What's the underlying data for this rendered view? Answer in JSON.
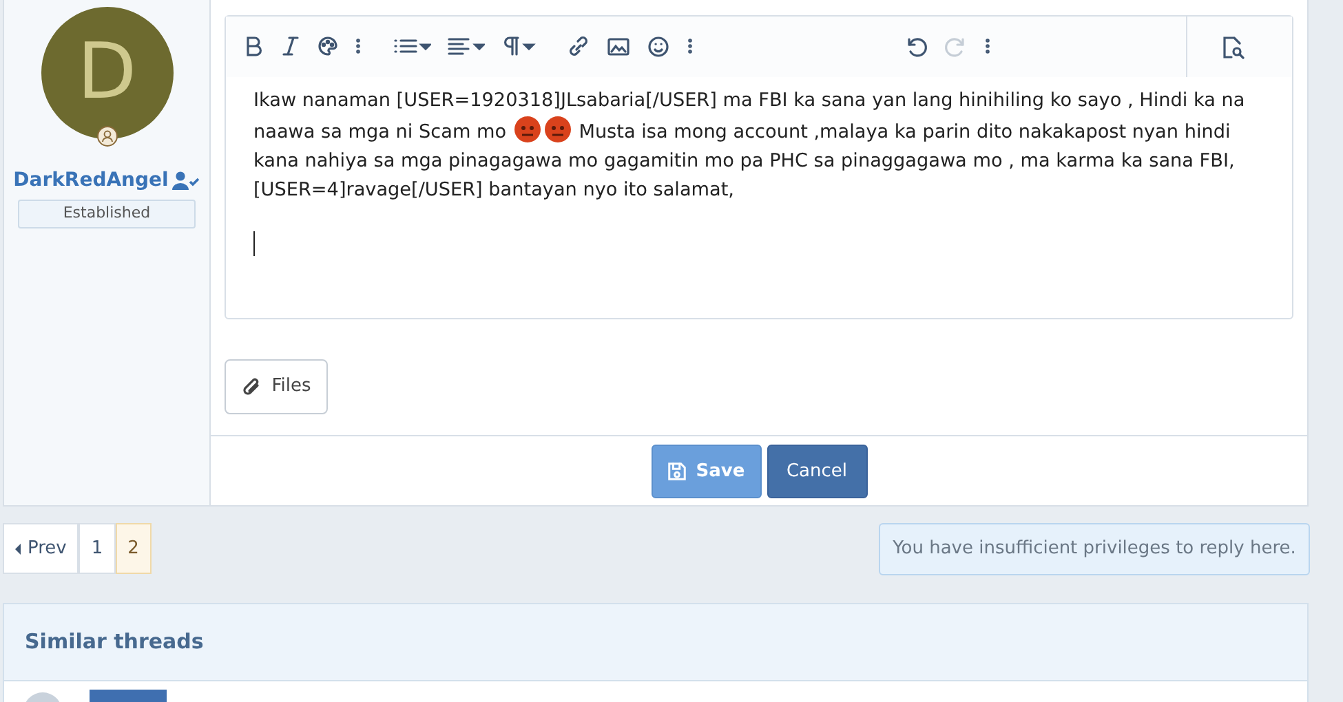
{
  "user": {
    "avatar_letter": "D",
    "name": "DarkRedAngel",
    "title": "Established"
  },
  "toolbar": [
    {
      "kind": "bold",
      "disabled": false
    },
    {
      "kind": "italic",
      "disabled": false
    },
    {
      "kind": "palette",
      "disabled": false
    },
    {
      "kind": "more",
      "disabled": false
    },
    {
      "kind": "list",
      "disabled": false
    },
    {
      "kind": "align",
      "disabled": false
    },
    {
      "kind": "paragraph",
      "disabled": false
    },
    {
      "kind": "link",
      "disabled": false
    },
    {
      "kind": "image",
      "disabled": false
    },
    {
      "kind": "smiley",
      "disabled": false
    },
    {
      "kind": "more",
      "disabled": false
    },
    {
      "kind": "undo",
      "disabled": false
    },
    {
      "kind": "redo",
      "disabled": true
    },
    {
      "kind": "more",
      "disabled": false
    },
    {
      "kind": "preview",
      "disabled": false
    }
  ],
  "editor": {
    "paragraphs": [
      [
        {
          "kind": "text",
          "text": "Ikaw nanaman [USER=1920318]JLsabaria[/USER] ma FBI ka sana yan lang hinihiling ko sayo , Hindi ka na naawa sa mga ni Scam mo "
        },
        {
          "kind": "emoji"
        },
        {
          "kind": "emoji"
        },
        {
          "kind": "text",
          "text": " Musta isa mong account ,malaya ka parin dito nakakapost nyan hindi kana nahiya sa mga pinagagawa mo gagamitin mo pa PHC sa pinaggagawa mo , ma karma ka sana FBI,"
        }
      ],
      [
        {
          "kind": "text",
          "text": "[USER=4]ravage[/USER] bantayan nyo ito salamat,"
        }
      ]
    ]
  },
  "files_button": "Files",
  "buttons": [
    {
      "kind": "save",
      "label": "Save"
    },
    {
      "kind": "cancel",
      "label": "Cancel"
    }
  ],
  "pagination": [
    {
      "kind": "prev",
      "label": "Prev",
      "selected": false
    },
    {
      "kind": "page",
      "label": "1",
      "selected": false
    },
    {
      "kind": "page",
      "label": "2",
      "selected": true
    }
  ],
  "notice": "You have insufficient privileges to reply here.",
  "similar_threads": {
    "title": "Similar threads"
  }
}
